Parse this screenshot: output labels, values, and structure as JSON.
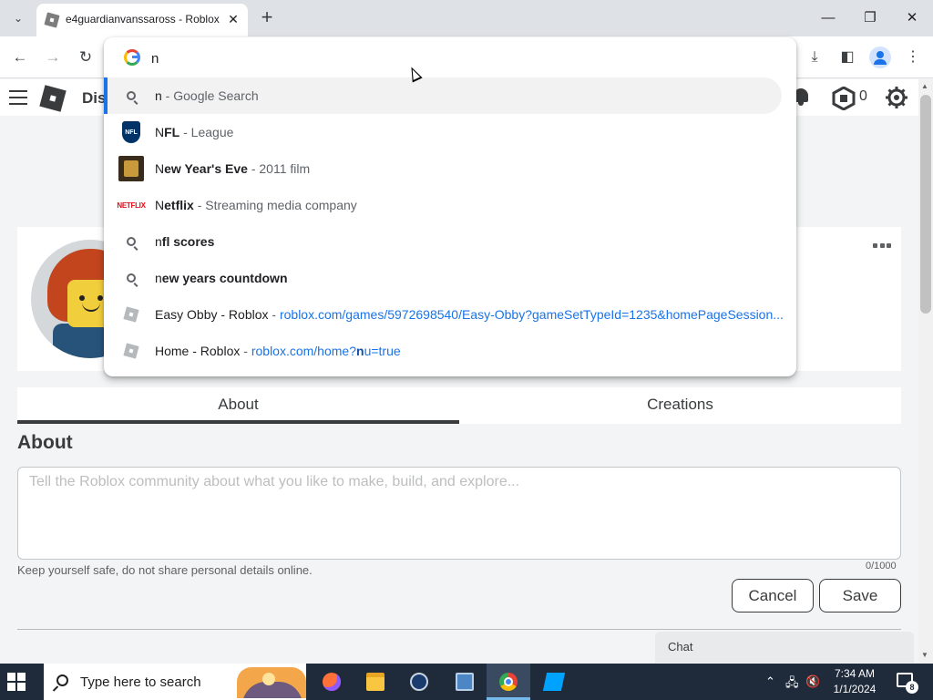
{
  "browser": {
    "tab_title": "e4guardianvanssaross - Roblox",
    "omnibox_value": "n",
    "suggestions": [
      {
        "type": "search",
        "icon": "search-icon",
        "bold": "",
        "match": "n",
        "rest": "",
        "sub": " - Google Search"
      },
      {
        "type": "entity",
        "icon": "nfl-icon",
        "match": "N",
        "bold": "FL",
        "sub": " - League"
      },
      {
        "type": "entity",
        "icon": "film-icon",
        "match": "N",
        "bold": "ew Year's Eve",
        "sub": " - 2011 film"
      },
      {
        "type": "entity",
        "icon": "netflix-icon",
        "match": "N",
        "bold": "etflix",
        "sub": " - Streaming media company"
      },
      {
        "type": "search",
        "icon": "search-icon",
        "match": "n",
        "bold": "fl scores",
        "sub": ""
      },
      {
        "type": "search",
        "icon": "search-icon",
        "match": "n",
        "bold": "ew years countdown",
        "sub": ""
      },
      {
        "type": "history",
        "icon": "roblox-favicon",
        "title": "Easy Obby - Roblox",
        "url": "roblox.com/games/5972698540/Easy-Obby?gameSetTypeId=1235&homePageSession..."
      },
      {
        "type": "history",
        "icon": "roblox-favicon",
        "title": "Home - Roblox",
        "url_pre": "roblox.com/home?",
        "url_match": "n",
        "url_post": "u=true"
      }
    ],
    "netflix_logo_text": "NETFLIX",
    "nfl_logo_text": "NFL"
  },
  "roblox": {
    "nav_discover": "Dis",
    "robux_count": "0",
    "tabs": [
      "About",
      "Creations"
    ],
    "about_heading": "About",
    "about_placeholder": "Tell the Roblox community about what you like to make, build, and explore...",
    "safety_note": "Keep yourself safe, do not share personal details online.",
    "char_count": "0/1000",
    "cancel_label": "Cancel",
    "save_label": "Save",
    "chat_label": "Chat"
  },
  "taskbar": {
    "search_placeholder": "Type here to search",
    "time": "7:34 AM",
    "date": "1/1/2024",
    "notification_count": "8"
  },
  "colors": {
    "accent_blue": "#1a73e8",
    "roblox_text": "#393b3d",
    "taskbar_bg": "#1f2a3a"
  }
}
